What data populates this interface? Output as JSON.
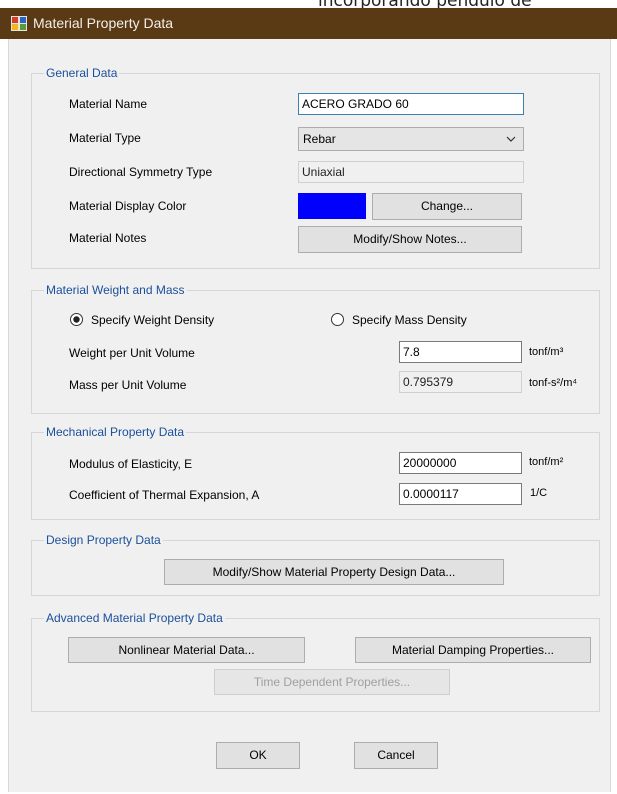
{
  "background_fragment": "incorporando pendulo de",
  "window": {
    "title": "Material Property Data"
  },
  "general": {
    "legend": "General Data",
    "material_name_label": "Material Name",
    "material_name_value": "ACERO GRADO 60",
    "material_type_label": "Material Type",
    "material_type_value": "Rebar",
    "symmetry_label": "Directional Symmetry Type",
    "symmetry_value": "Uniaxial",
    "display_color_label": "Material Display Color",
    "display_color": "#0000ff",
    "change_button": "Change...",
    "notes_label": "Material Notes",
    "notes_button": "Modify/Show Notes..."
  },
  "weight_mass": {
    "legend": "Material Weight and Mass",
    "radio_weight": "Specify Weight Density",
    "radio_mass": "Specify Mass Density",
    "selected": "Specify Weight Density",
    "weight_label": "Weight per Unit Volume",
    "weight_value": "7.8",
    "weight_unit": "tonf/m³",
    "mass_label": "Mass per Unit Volume",
    "mass_value": "0.795379",
    "mass_unit": "tonf-s²/m⁴"
  },
  "mechanical": {
    "legend": "Mechanical Property Data",
    "modulus_label": "Modulus of Elasticity,  E",
    "modulus_value": "20000000",
    "modulus_unit": "tonf/m²",
    "thermal_label": "Coefficient of Thermal Expansion,  A",
    "thermal_value": "0.0000117",
    "thermal_unit": "1/C"
  },
  "design": {
    "legend": "Design Property Data",
    "button": "Modify/Show Material Property Design Data..."
  },
  "advanced": {
    "legend": "Advanced Material Property Data",
    "nonlinear_button": "Nonlinear Material Data...",
    "damping_button": "Material Damping Properties...",
    "time_button": "Time Dependent Properties..."
  },
  "footer": {
    "ok": "OK",
    "cancel": "Cancel"
  }
}
